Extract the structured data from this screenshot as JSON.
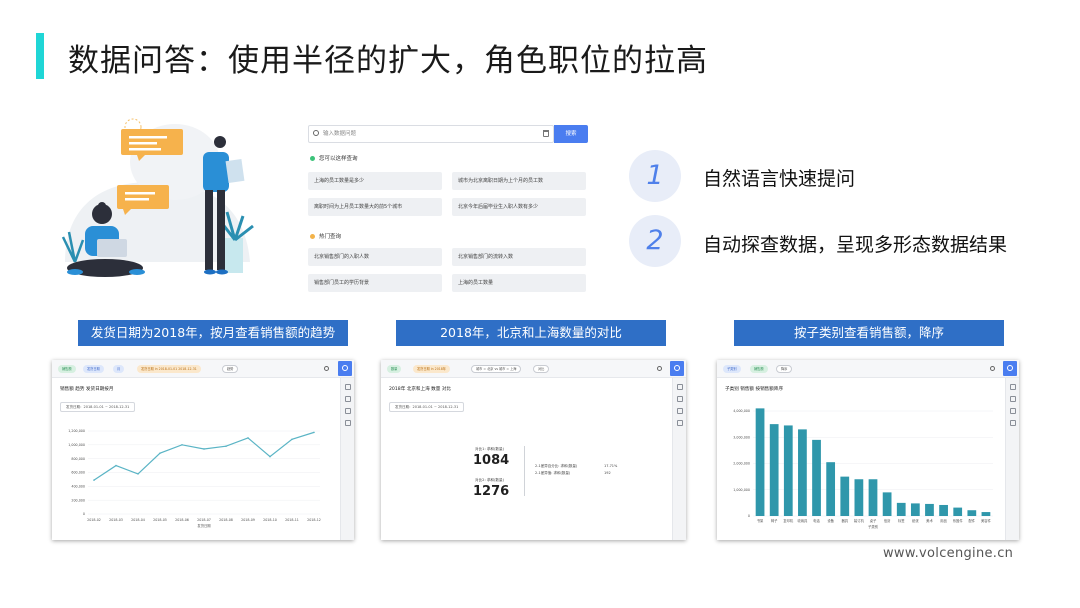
{
  "title": "数据问答：使用半径的扩大，角色职位的拉高",
  "qa_panel": {
    "search_placeholder": "输入数据问题",
    "search_button": "搜索",
    "section_suggest": "您可以这样查询",
    "suggestions": [
      "上海的员工数量是多少",
      "城市为北京离职日期为上个月的员工数",
      "离职时间为上月员工数量大的前5个城市",
      "北京今年后届毕业生入职人数有多少"
    ],
    "section_hot": "热门查询",
    "hot": [
      "北京销售部门的入职人数",
      "北京销售部门的流转入数",
      "销售部门员工的学历背景",
      "上海的员工数量"
    ]
  },
  "features": [
    {
      "num": "1",
      "text": "自然语言快速提问"
    },
    {
      "num": "2",
      "text": "自动探查数据，呈现多形态数据结果"
    }
  ],
  "captions": [
    "发货日期为2018年，按月查看销售额的趋势",
    "2018年，北京和上海数量的对比",
    "按子类别查看销售额，降序"
  ],
  "card1": {
    "tags": [
      "销售额",
      "发货日期",
      "月",
      "发货日期 in 2018-01-01 2018-12-31",
      "趋势"
    ],
    "chart_title": "销售额 趋势 发货日期按月",
    "date_range": "发货日期：2018-01-01 ~ 2018-12-31",
    "rail_icons": [
      "bar-chart-icon",
      "table-icon",
      "download-icon",
      "pin-icon"
    ]
  },
  "card2": {
    "tags": [
      "数量",
      "发货日期 in 2018年",
      "城市 = 北京 vs 城市 = 上海",
      "对比"
    ],
    "chart_title": "2018年 北京和上海 数量 对比",
    "date_range": "发货日期：2018-01-01 ~ 2018-12-31",
    "metric1_label": "对比1: 求和(数量)",
    "metric1_value": "1084",
    "metric2_label": "对比2: 求和(数量)",
    "metric2_value": "1276",
    "cmp1_label": "2-1差异百分比: 求和(数量)",
    "cmp1_value": "17.71%",
    "cmp2_label": "2-1差异值: 求和(数量)",
    "cmp2_value": "192"
  },
  "card3": {
    "tags": [
      "子类别",
      "销售额",
      "降序"
    ],
    "chart_title": "子类别 销售额 按销售额降序"
  },
  "chart_data": [
    {
      "type": "line",
      "x": [
        "2018-02",
        "2018-03",
        "2018-04",
        "2018-05",
        "2018-06",
        "2018-07",
        "2018-08",
        "2018-09",
        "2018-10",
        "2018-11",
        "2018-12"
      ],
      "values": [
        490000,
        700000,
        580000,
        880000,
        1000000,
        940000,
        980000,
        1100000,
        830000,
        1080000,
        1180000
      ],
      "ylim": [
        0,
        1200000
      ],
      "yticks": [
        "0",
        "200,000",
        "400,000",
        "600,000",
        "800,000",
        "1,000,000",
        "1,200,000"
      ],
      "xlabel": "发货日期",
      "color": "#5ab4c5"
    },
    {
      "type": "bar",
      "categories": [
        "书架",
        "椅子",
        "复印机",
        "收纳具",
        "电话",
        "设备",
        "器具",
        "装订机",
        "桌子",
        "信封",
        "标签",
        "纸张",
        "美术",
        "用品",
        "系固件",
        "配件",
        "美容件"
      ],
      "values": [
        4100000,
        3500000,
        3450000,
        3300000,
        2900000,
        2050000,
        1500000,
        1400000,
        1400000,
        900000,
        500000,
        480000,
        460000,
        420000,
        320000,
        220000,
        150000
      ],
      "ylim": [
        0,
        4000000
      ],
      "yticks": [
        "0",
        "1,000,000",
        "2,000,000",
        "3,000,000",
        "4,000,000"
      ],
      "xlabel": "子类别",
      "color": "#2f97ab"
    }
  ],
  "footer": "www.volcengine.cn"
}
